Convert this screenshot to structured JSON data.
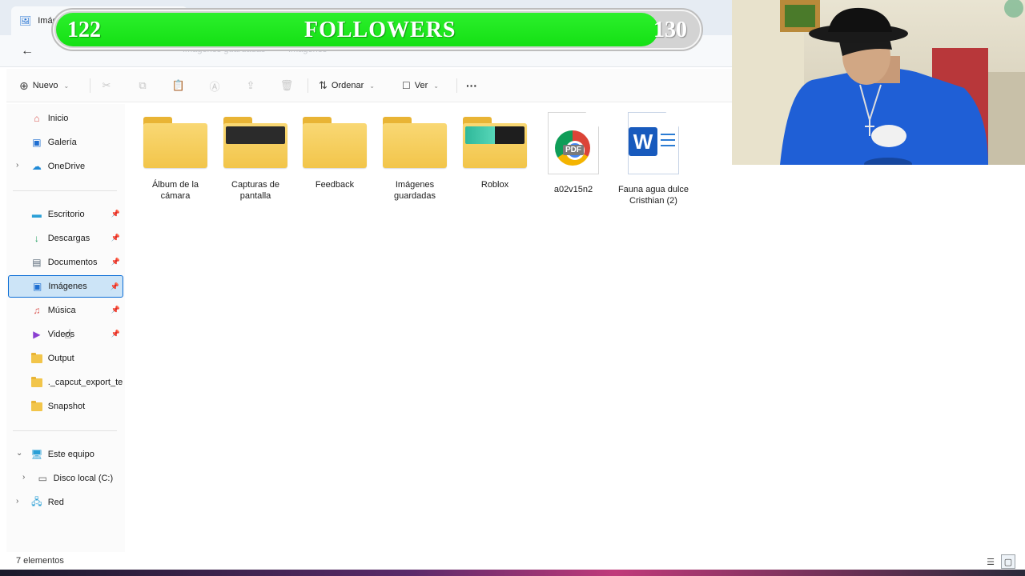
{
  "window": {
    "tab_title": "Imágenes"
  },
  "address": {
    "ghost_crumbs": [
      "Imágenes guardadas",
      "Imágenes"
    ]
  },
  "commands": {
    "new": "Nuevo",
    "sort": "Ordenar",
    "view": "Ver",
    "more": "···"
  },
  "sidebar": {
    "quick": [
      {
        "label": "Inicio"
      },
      {
        "label": "Galería"
      },
      {
        "label": "OneDrive"
      }
    ],
    "pinned": [
      {
        "label": "Escritorio"
      },
      {
        "label": "Descargas"
      },
      {
        "label": "Documentos"
      },
      {
        "label": "Imágenes"
      },
      {
        "label": "Música"
      },
      {
        "label": "Videos"
      },
      {
        "label": "Output"
      },
      {
        "label": "._capcut_export_te"
      },
      {
        "label": "Snapshot"
      }
    ],
    "this_pc": "Este equipo",
    "local_disk": "Disco local (C:)",
    "network": "Red"
  },
  "items": [
    {
      "label": "Álbum de la cámara",
      "type": "folder"
    },
    {
      "label": "Capturas de pantalla",
      "type": "folder"
    },
    {
      "label": "Feedback",
      "type": "folder"
    },
    {
      "label": "Imágenes guardadas",
      "type": "folder"
    },
    {
      "label": "Roblox",
      "type": "folder"
    },
    {
      "label": "a02v15n2",
      "type": "pdf"
    },
    {
      "label": "Fauna agua dulce Cristhian (2)",
      "type": "word"
    }
  ],
  "status": {
    "count": "7 elementos"
  },
  "overlay": {
    "current": "122",
    "label": "FOLLOWERS",
    "goal": "130",
    "progress": 0.938
  },
  "colors": {
    "accent": "#0b6dd6",
    "selection": "#cce4f7",
    "progress_green": "#14e014",
    "folder": "#f2c54a"
  }
}
